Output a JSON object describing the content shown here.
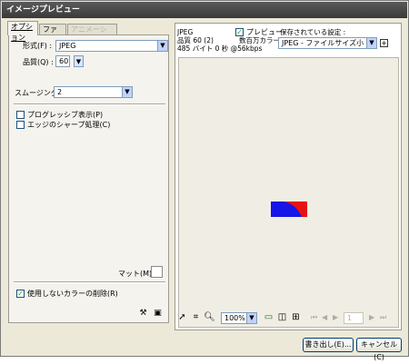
{
  "window": {
    "title": "イメージプレビュー"
  },
  "tabs": [
    {
      "label": "オプション",
      "active": true,
      "enabled": true
    },
    {
      "label": "ファイル",
      "active": false,
      "enabled": true
    },
    {
      "label": "アニメーション",
      "active": false,
      "enabled": false
    }
  ],
  "options": {
    "format_label": "形式(F) :",
    "format_value": "JPEG",
    "quality_label": "品質(Q) :",
    "quality_value": "60",
    "smoothing_label": "スムージング",
    "smoothing_value": "2",
    "progressive_label": "プログレッシブ表示(P)",
    "progressive_checked": false,
    "sharpen_label": "エッジのシャープ処理(C)",
    "sharpen_checked": false,
    "matte_label": "マット(M) :",
    "remove_unused_label": "使用しないカラーの削除(R)",
    "remove_unused_checked": true
  },
  "preview_info": {
    "format": "JPEG",
    "quality": "品質 60 (2)",
    "size": "485 バイト 0 秒 @56kbps",
    "preview_label": "プレビュー",
    "preview_checked": true,
    "colors_label": "数百万カラー",
    "saved_settings_label": "保存されている設定 :",
    "saved_settings_value": "JPEG - ファイルサイズ小"
  },
  "toolbar": {
    "zoom_value": "100%",
    "frame_value": "1"
  },
  "buttons": {
    "export_label": "書き出し(E)...",
    "cancel_label": "キャンセル(C)"
  },
  "colors": {
    "shape_blue": "#1515e8",
    "shape_red": "#e81111",
    "preview_bg": "#f0eee4"
  }
}
